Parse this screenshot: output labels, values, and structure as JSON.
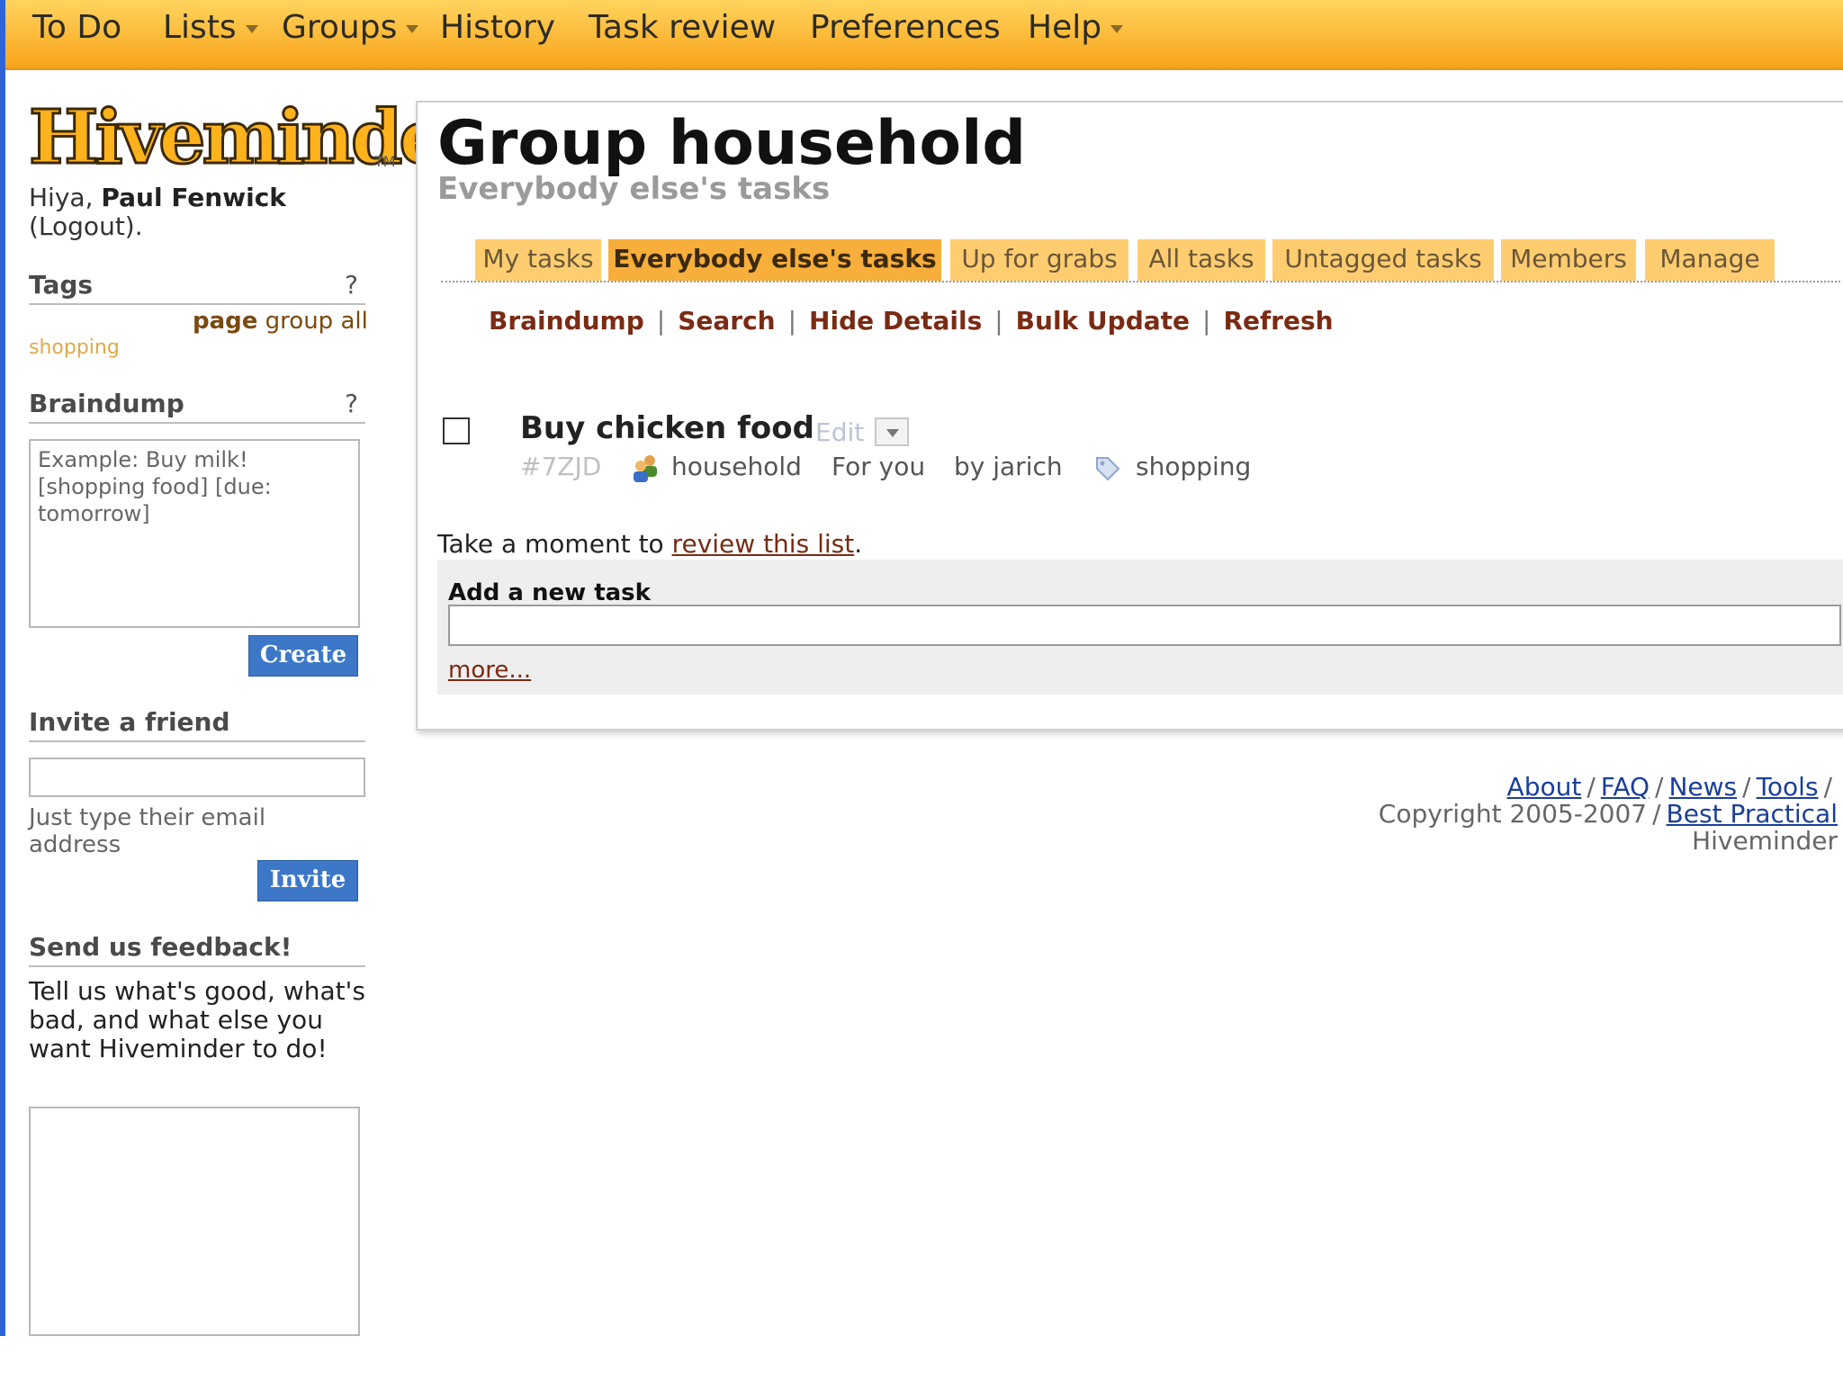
{
  "topnav": {
    "items": [
      {
        "label": "To Do"
      },
      {
        "label": "Lists"
      },
      {
        "label": "Groups"
      },
      {
        "label": "History"
      },
      {
        "label": "Task review"
      },
      {
        "label": "Preferences"
      },
      {
        "label": "Help"
      }
    ]
  },
  "sidebar": {
    "logo": "Hiveminder",
    "logo_tm": "TM",
    "greeting_prefix": "Hiya,",
    "user_name": "Paul Fenwick",
    "logout_text": "(Logout).",
    "tags": {
      "heading": "Tags",
      "help": "?",
      "items": [
        "page",
        "group",
        "all",
        "shopping"
      ]
    },
    "braindump": {
      "heading": "Braindump",
      "help": "?",
      "placeholder": "Example: Buy milk! [shopping food] [due: tomorrow]",
      "button": "Create"
    },
    "invite": {
      "heading": "Invite a friend",
      "hint": "Just type their email address",
      "button": "Invite"
    },
    "feedback": {
      "heading": "Send us feedback!",
      "text": "Tell us what's good, what's bad, and what else you want Hiveminder to do!"
    }
  },
  "main": {
    "title": "Group household",
    "subtitle": "Everybody else's tasks",
    "tabs": [
      {
        "label": "My tasks"
      },
      {
        "label": "Everybody else's tasks"
      },
      {
        "label": "Up for grabs"
      },
      {
        "label": "All tasks"
      },
      {
        "label": "Untagged tasks"
      },
      {
        "label": "Members"
      },
      {
        "label": "Manage"
      }
    ],
    "actions": [
      "Braindump",
      "Search",
      "Hide Details",
      "Bulk Update",
      "Refresh"
    ],
    "task": {
      "title": "Buy chicken food",
      "edit": "Edit",
      "id": "#7ZJD",
      "group": "household",
      "owner": "For you",
      "requestor": "by jarich",
      "tag": "shopping"
    },
    "review": {
      "prefix": "Take a moment to",
      "link": "review this list",
      "suffix": "."
    },
    "add_task": {
      "label": "Add a new task",
      "more": "more..."
    }
  },
  "footer": {
    "links": [
      "About",
      "FAQ",
      "News",
      "Tools"
    ],
    "copyright": "Copyright 2005-2007",
    "company": "Best Practical",
    "app": "Hiveminder"
  },
  "colors": {
    "nav_gradient_top": "#ffd45e",
    "nav_gradient_bottom": "#f9a41a",
    "tab": "#ffcd70",
    "tab_active": "#f7ae3b",
    "link": "#7a2b14",
    "button": "#3d77c8"
  }
}
